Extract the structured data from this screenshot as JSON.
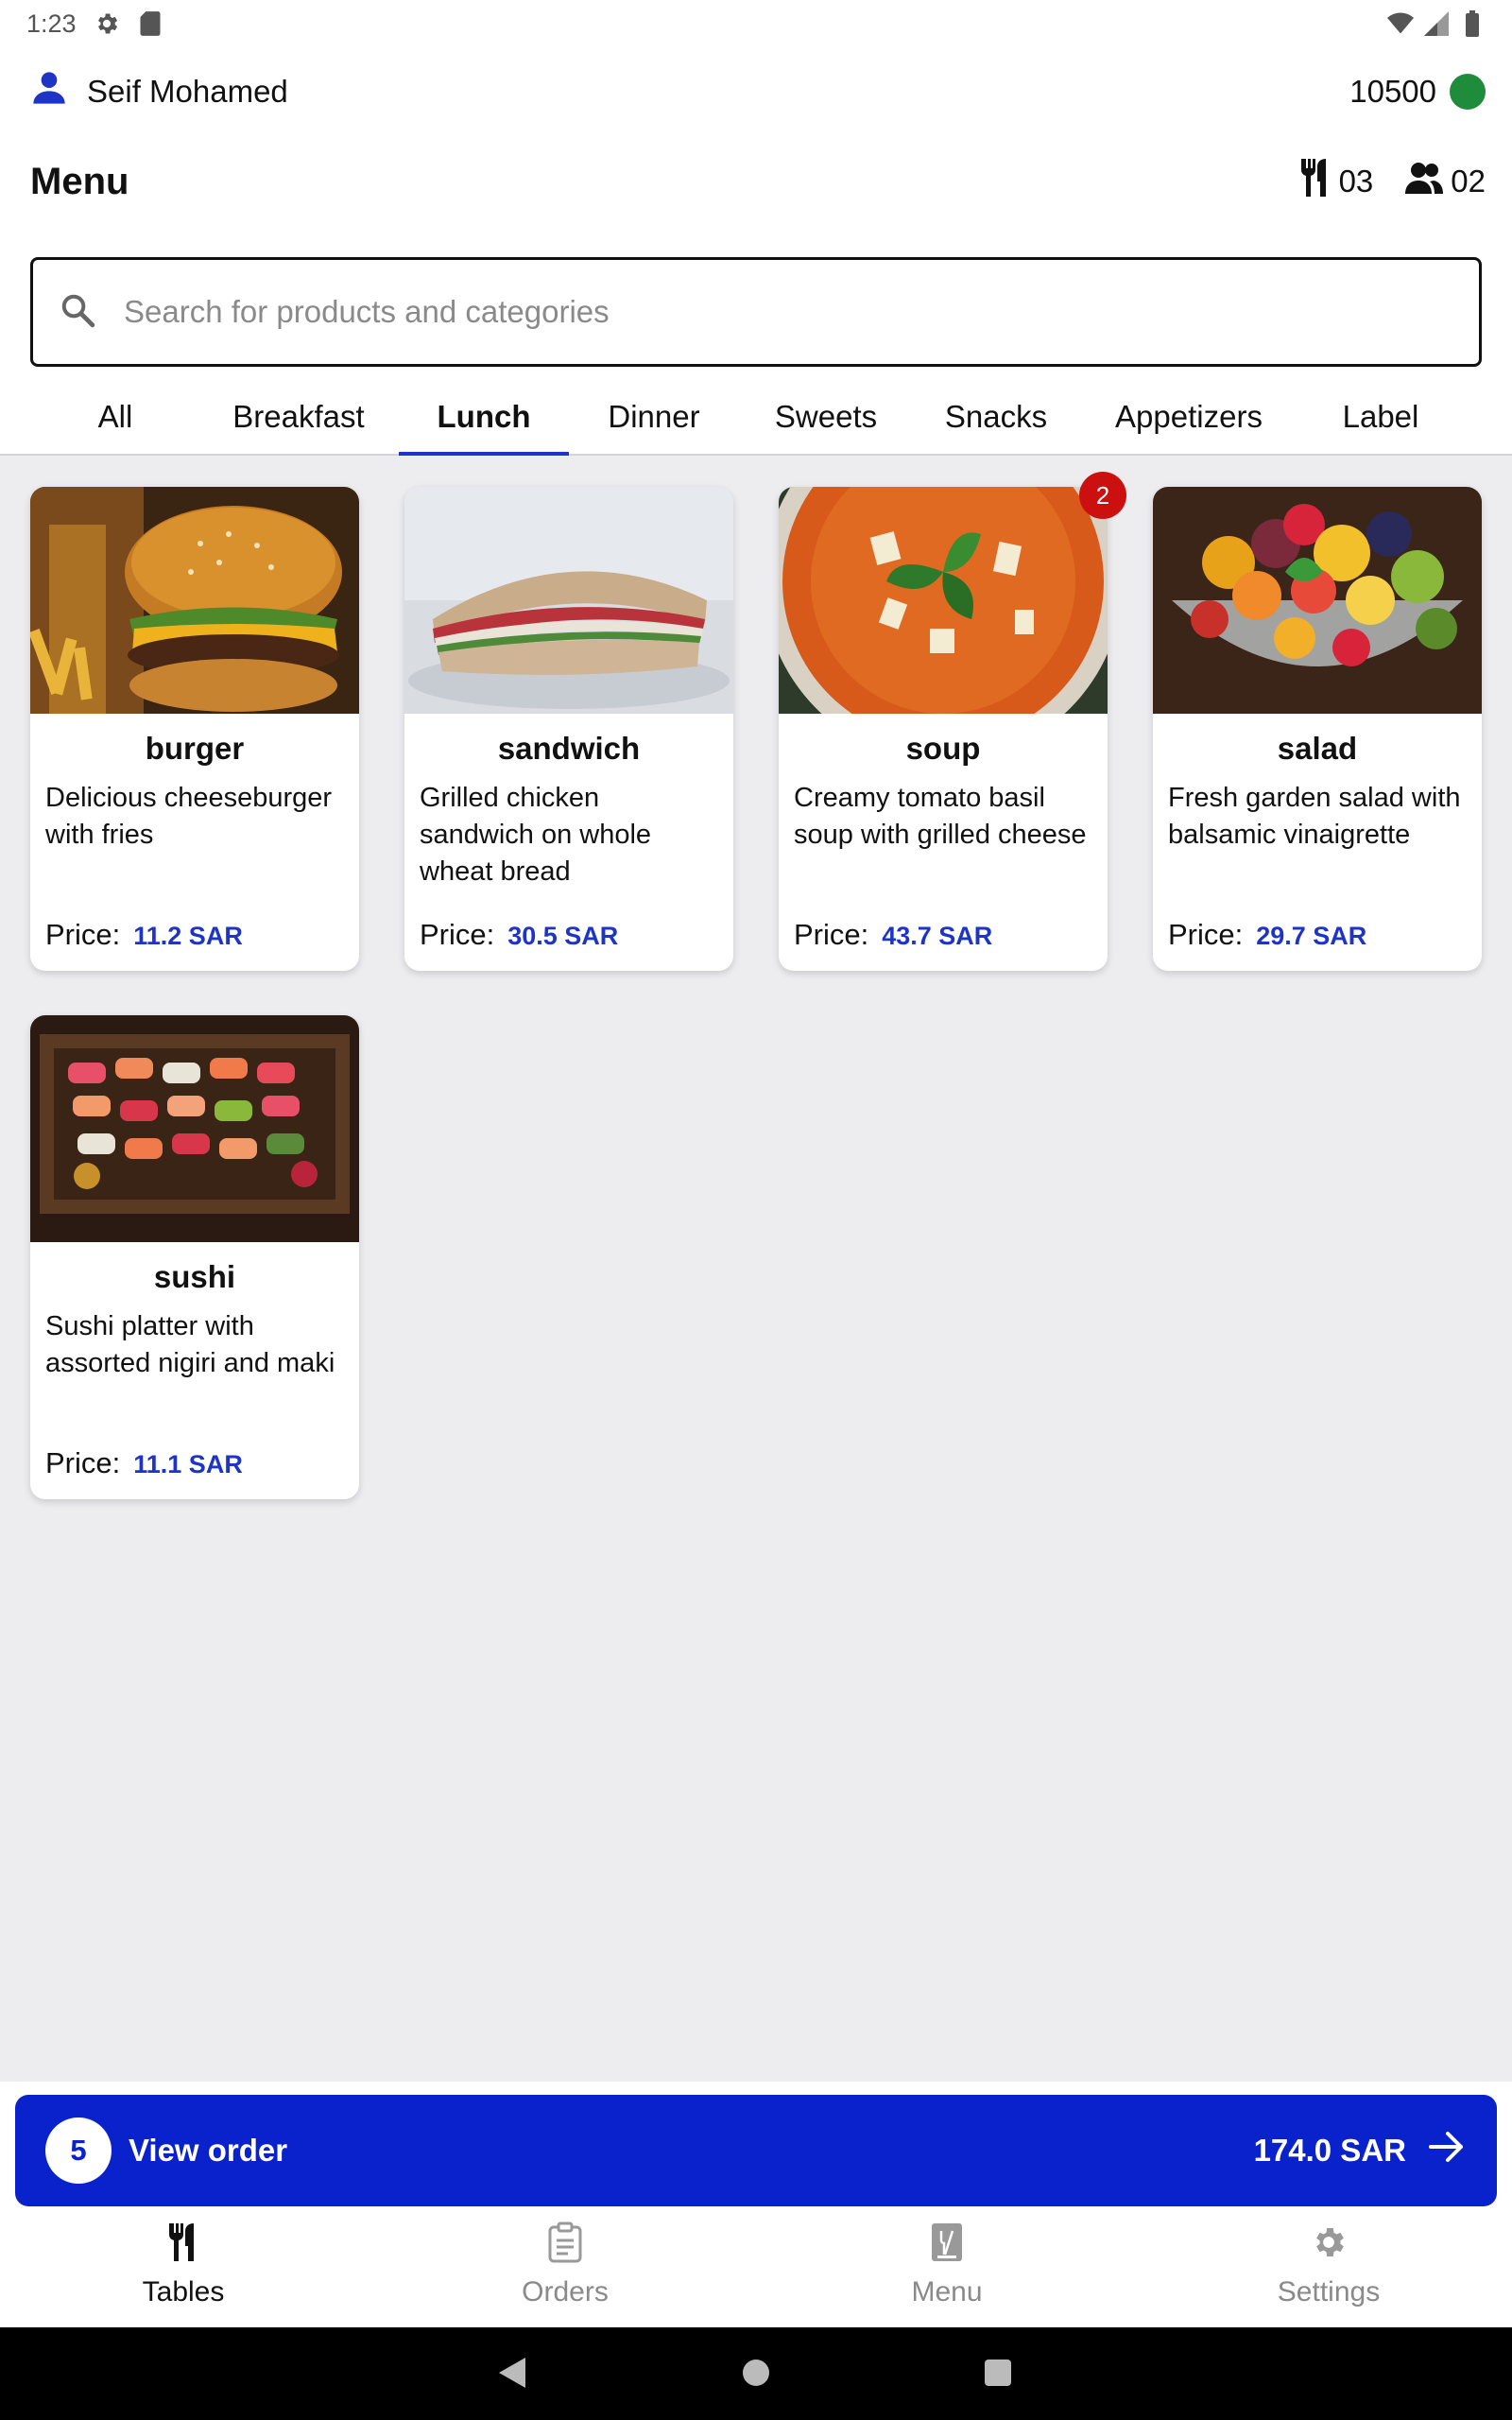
{
  "status_bar": {
    "time": "1:23"
  },
  "user": {
    "name": "Seif Mohamed",
    "balance": "10500",
    "status_color": "#1e8c3a"
  },
  "header": {
    "title": "Menu",
    "tables_count": "03",
    "guests_count": "02"
  },
  "search": {
    "placeholder": "Search for products and categories"
  },
  "tabs": [
    {
      "label": "All"
    },
    {
      "label": "Breakfast"
    },
    {
      "label": "Lunch",
      "active": true
    },
    {
      "label": "Dinner"
    },
    {
      "label": "Sweets"
    },
    {
      "label": "Snacks"
    },
    {
      "label": "Appetizers"
    },
    {
      "label": "Label"
    }
  ],
  "products": [
    {
      "name": "burger",
      "description": "Delicious cheeseburger with fries",
      "price_label": "Price:",
      "price": "11.2 SAR"
    },
    {
      "name": "sandwich",
      "description": "Grilled chicken sandwich on whole wheat bread",
      "price_label": "Price:",
      "price": "30.5 SAR"
    },
    {
      "name": "soup",
      "description": "Creamy tomato basil soup with grilled cheese",
      "price_label": "Price:",
      "price": "43.7 SAR",
      "badge": "2"
    },
    {
      "name": "salad",
      "description": "Fresh garden salad with balsamic vinaigrette",
      "price_label": "Price:",
      "price": "29.7 SAR"
    },
    {
      "name": "sushi",
      "description": "Sushi platter with assorted nigiri and maki",
      "price_label": "Price:",
      "price": "11.1 SAR"
    }
  ],
  "order_bar": {
    "item_count": "5",
    "label": "View order",
    "total": "174.0 SAR"
  },
  "bottom_nav": [
    {
      "label": "Tables",
      "icon": "fork-knife-icon",
      "active": true
    },
    {
      "label": "Orders",
      "icon": "clipboard-icon"
    },
    {
      "label": "Menu",
      "icon": "menu-book-icon"
    },
    {
      "label": "Settings",
      "icon": "gear-icon"
    }
  ],
  "colors": {
    "accent": "#1e34c6",
    "order_bar": "#0a22cc",
    "badge": "#cc1010",
    "background": "#ededf0"
  }
}
